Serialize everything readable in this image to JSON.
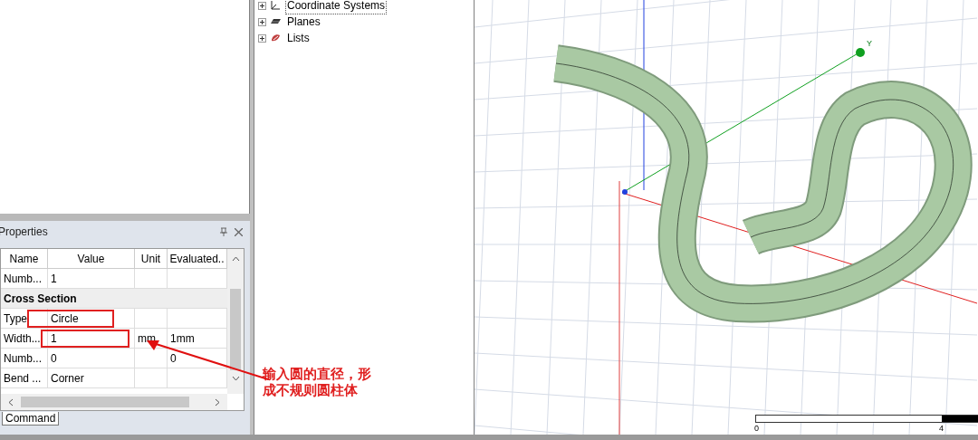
{
  "tree": {
    "items": [
      {
        "label": "Coordinate Systems",
        "expanded": false,
        "selected": true
      },
      {
        "label": "Planes",
        "expanded": false,
        "selected": false
      },
      {
        "label": "Lists",
        "expanded": false,
        "selected": false
      }
    ]
  },
  "properties": {
    "title": "Properties",
    "columns": [
      "Name",
      "Value",
      "Unit",
      "Evaluated.."
    ],
    "rows": [
      {
        "kind": "row",
        "cells": [
          "Numb...",
          "1",
          "",
          ""
        ],
        "highlighted": false
      },
      {
        "kind": "group",
        "label": "Cross Section"
      },
      {
        "kind": "row",
        "cells": [
          "Type",
          "Circle",
          "",
          ""
        ],
        "highlighted": true
      },
      {
        "kind": "row",
        "cells": [
          "Width...",
          "1",
          "mm",
          "1mm"
        ],
        "highlighted": true
      },
      {
        "kind": "row",
        "cells": [
          "Numb...",
          "0",
          "",
          "0"
        ],
        "highlighted": false
      },
      {
        "kind": "row",
        "cells": [
          "Bend ...",
          "Corner",
          "",
          ""
        ],
        "highlighted": false
      }
    ],
    "tabs": [
      {
        "label": "Command",
        "selected": true
      }
    ]
  },
  "annotation": {
    "text": "输入圆的直径，形成不规则圆柱体"
  },
  "viewport": {
    "axis_label": "Y",
    "scale_labels": [
      "0",
      "4"
    ]
  }
}
